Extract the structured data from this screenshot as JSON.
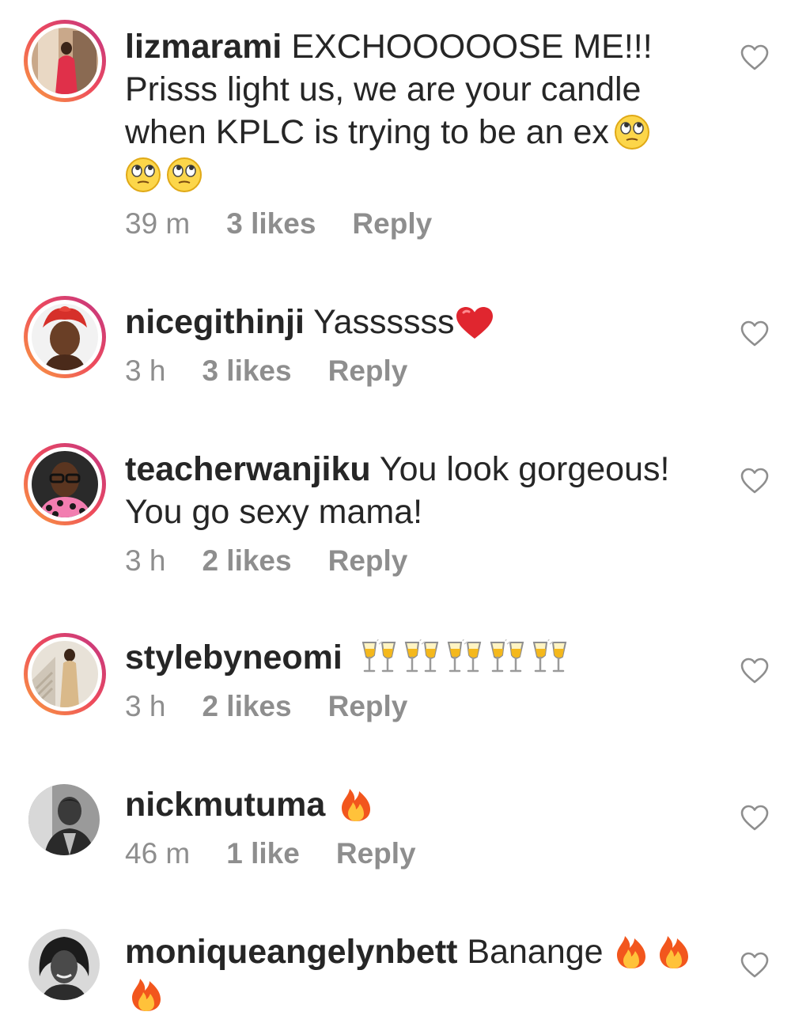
{
  "comments": [
    {
      "username": "lizmarami",
      "text": "EXCHOOOOOSE ME!!! Prisss light  us, we are your candle when KPLC is trying to be an ex",
      "emoji": [
        "face-with-rolling-eyes-icon",
        "face-with-rolling-eyes-icon",
        "face-with-rolling-eyes-icon"
      ],
      "time": "39 m",
      "likes": "3 likes",
      "reply": "Reply",
      "story_ring": true
    },
    {
      "username": "nicegithinji",
      "text": "Yassssss",
      "emoji": [
        "red-heart-icon"
      ],
      "time": "3 h",
      "likes": "3 likes",
      "reply": "Reply",
      "story_ring": true
    },
    {
      "username": "teacherwanjiku",
      "text": "You look gorgeous! You go sexy mama!",
      "emoji": [],
      "time": "3 h",
      "likes": "2 likes",
      "reply": "Reply",
      "story_ring": true
    },
    {
      "username": "stylebyneomi",
      "text": "",
      "emoji": [
        "clinking-glasses-icon",
        "clinking-glasses-icon",
        "clinking-glasses-icon",
        "clinking-glasses-icon",
        "clinking-glasses-icon"
      ],
      "time": "3 h",
      "likes": "2 likes",
      "reply": "Reply",
      "story_ring": true
    },
    {
      "username": "nickmutuma",
      "text": "",
      "emoji": [
        "fire-icon"
      ],
      "time": "46 m",
      "likes": "1 like",
      "reply": "Reply",
      "story_ring": false
    },
    {
      "username": "moniqueangelynbett",
      "text": "Banange",
      "emoji": [
        "fire-icon",
        "fire-icon",
        "fire-icon"
      ],
      "time": "",
      "likes": "",
      "reply": "",
      "story_ring": false
    }
  ],
  "colors": {
    "text": "#262626",
    "meta": "#8e8e8e",
    "heart_outline": "#8e8e8e",
    "ring_start": "#f9a03f",
    "ring_end": "#c13584"
  }
}
